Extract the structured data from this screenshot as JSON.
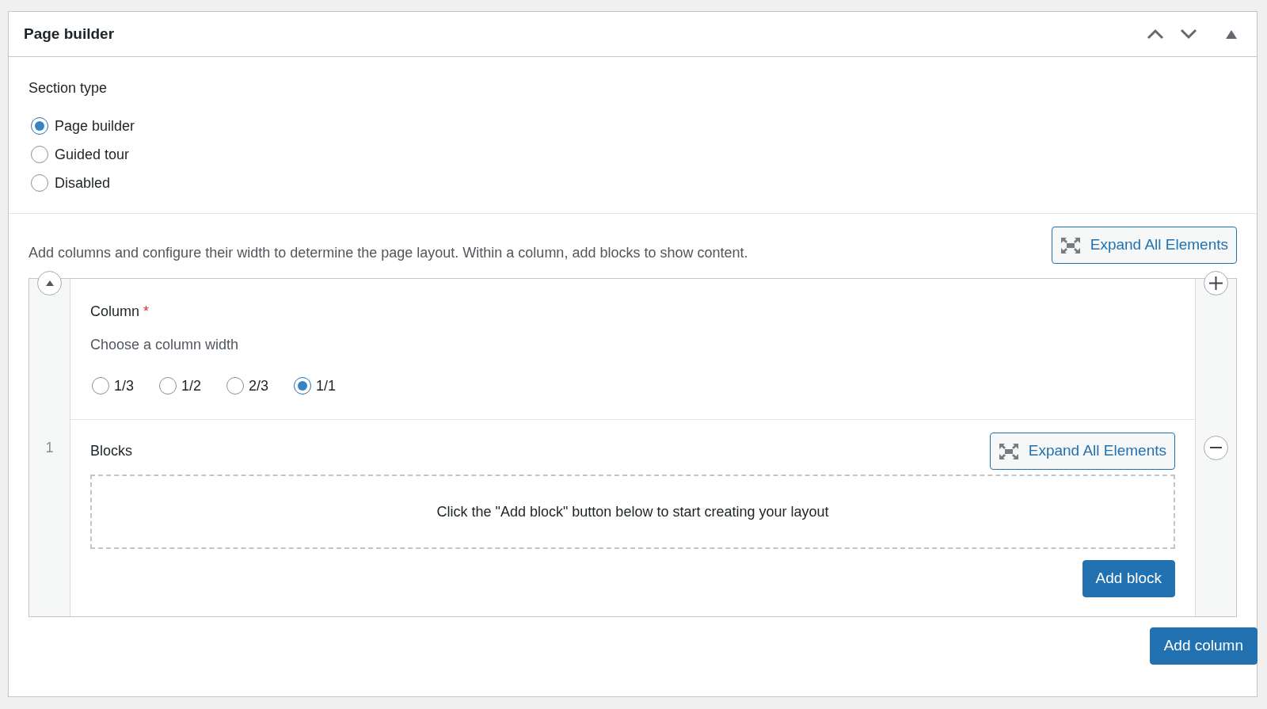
{
  "panel": {
    "title": "Page builder"
  },
  "section_type": {
    "label": "Section type",
    "options": [
      {
        "label": "Page builder",
        "selected": true
      },
      {
        "label": "Guided tour",
        "selected": false
      },
      {
        "label": "Disabled",
        "selected": false
      }
    ]
  },
  "layout": {
    "description": "Add columns and configure their width to determine the page layout. Within a column, add blocks to show content.",
    "expand_button": "Expand All Elements",
    "columns": [
      {
        "number": "1",
        "label": "Column",
        "required_mark": "*",
        "hint": "Choose a column width",
        "widths": [
          {
            "label": "1/3",
            "selected": false
          },
          {
            "label": "1/2",
            "selected": false
          },
          {
            "label": "2/3",
            "selected": false
          },
          {
            "label": "1/1",
            "selected": true
          }
        ],
        "blocks": {
          "label": "Blocks",
          "expand_button": "Expand All Elements",
          "empty_message": "Click the \"Add block\" button below to start creating your layout",
          "add_button": "Add block"
        }
      }
    ],
    "add_column_button": "Add column"
  }
}
